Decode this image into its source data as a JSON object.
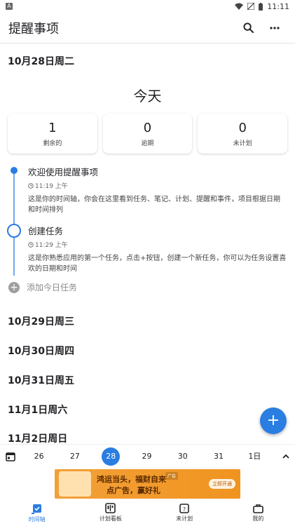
{
  "status_bar": {
    "time": "11:11",
    "app_badge": "A"
  },
  "app_bar": {
    "title": "提醒事项"
  },
  "today": {
    "date_header": "10月28日周二",
    "title": "今天",
    "stats": [
      {
        "value": "1",
        "label": "剩余的"
      },
      {
        "value": "0",
        "label": "逾期"
      },
      {
        "value": "0",
        "label": "未计划"
      }
    ],
    "tasks": [
      {
        "title": "欢迎使用提醒事项",
        "time": "11:19 上午",
        "desc": "这是你的时间轴，你会在这里看到任务、笔记、计划、提醒和事件，项目根据日期和时间排列"
      },
      {
        "title": "创建任务",
        "time": "11:29 上午",
        "desc": "这是你熟悉应用的第一个任务，点击+按钮，创建一个新任务，你可以为任务设置喜欢的日期和时间"
      }
    ],
    "add_label": "添加今日任务"
  },
  "days": [
    {
      "header": "10月29日周三"
    },
    {
      "header": "10月30日周四"
    },
    {
      "header": "10月31日周五"
    },
    {
      "header": "11月1日周六"
    },
    {
      "header": "11月2日周日"
    }
  ],
  "date_strip": {
    "days": [
      "26",
      "27",
      "28",
      "29",
      "30",
      "31",
      "1日"
    ],
    "selected_index": 2
  },
  "ad": {
    "line1": "鸿运当头，福财自来",
    "line2": "点广告，赢好礼",
    "button": "立即开通",
    "tag": "广告"
  },
  "bottom_nav": [
    {
      "label": "时间轴",
      "icon": "timeline-check-icon",
      "active": true
    },
    {
      "label": "计划看板",
      "icon": "board-icon",
      "active": false
    },
    {
      "label": "未计划",
      "icon": "calendar-question-icon",
      "active": false
    },
    {
      "label": "我的",
      "icon": "briefcase-icon",
      "active": false
    }
  ],
  "colors": {
    "accent": "#2a7de1",
    "timeline": "#6fa8f0"
  }
}
